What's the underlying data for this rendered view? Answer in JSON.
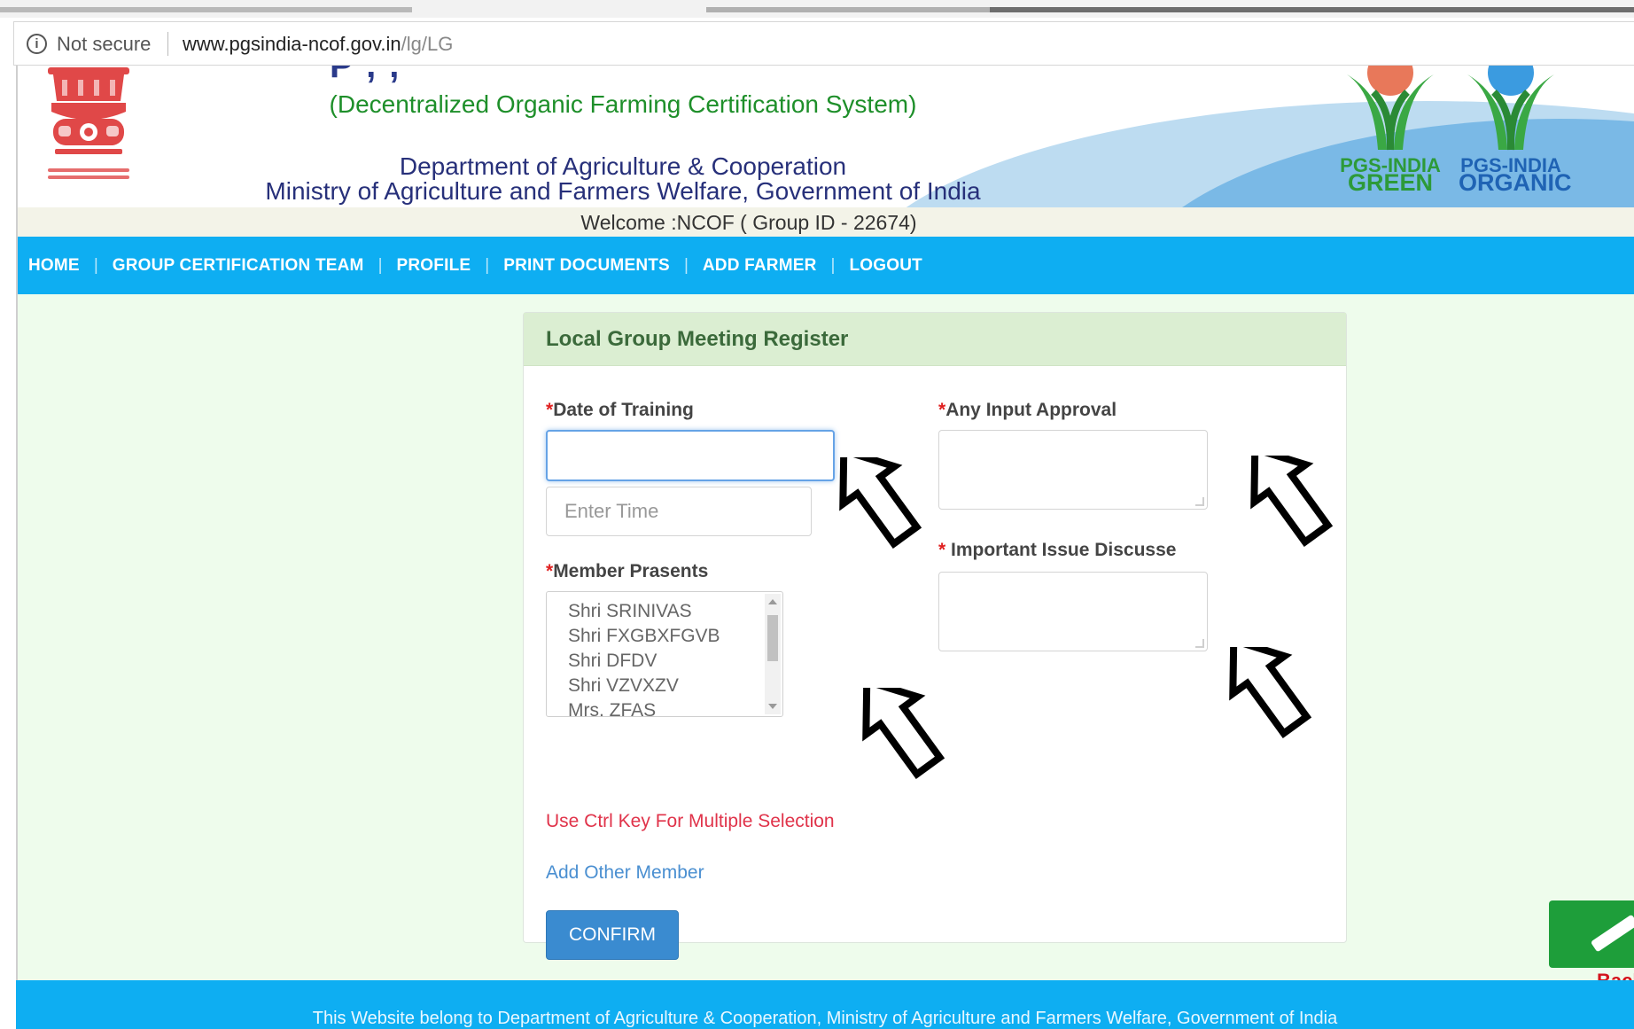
{
  "browser": {
    "security_label": "Not secure",
    "url_host": "www.pgsindia-ncof.gov.in",
    "url_path": "/lg/LG"
  },
  "header": {
    "subtitle": "(Decentralized Organic Farming Certification System)",
    "department": "Department of Agriculture & Cooperation",
    "ministry": "Ministry of Agriculture and Farmers Welfare, Government of India",
    "welcome": "Welcome :NCOF ( Group ID - 22674)",
    "logos": [
      {
        "line1": "PGS-INDIA",
        "line2": "GREEN"
      },
      {
        "line1": "PGS-INDIA",
        "line2": "ORGANIC"
      }
    ]
  },
  "nav": {
    "items": [
      "HOME",
      "GROUP CERTIFICATION TEAM",
      "PROFILE",
      "PRINT DOCUMENTS",
      "ADD FARMER",
      "LOGOUT"
    ],
    "separator": "|"
  },
  "form": {
    "title": "Local Group Meeting Register",
    "required_mark": "*",
    "date_label": "Date of Training",
    "date_value": "",
    "time_placeholder": "Enter Time",
    "members_label": "Member Prasents",
    "members": [
      "Shri SRINIVAS",
      "Shri FXGBXFGVB",
      "Shri DFDV",
      "Shri VZVXZV",
      "Mrs. ZFAS"
    ],
    "hint": "Use Ctrl Key For Multiple Selection",
    "add_member": "Add Other Member",
    "confirm": "CONFIRM",
    "input_approval_label": "Any Input Approval",
    "issue_label": " Important Issue Discusse"
  },
  "side": {
    "back_label": "Back"
  },
  "footer": {
    "text": "This Website belong to Department of Agriculture & Cooperation, Ministry of Agriculture and Farmers Welfare, Government of India"
  },
  "colors": {
    "nav": "#0eaef2",
    "page_bg": "#eefcec",
    "panel_heading": "#dbeed2",
    "confirm": "#3a8bd0",
    "required": "#e02020"
  }
}
